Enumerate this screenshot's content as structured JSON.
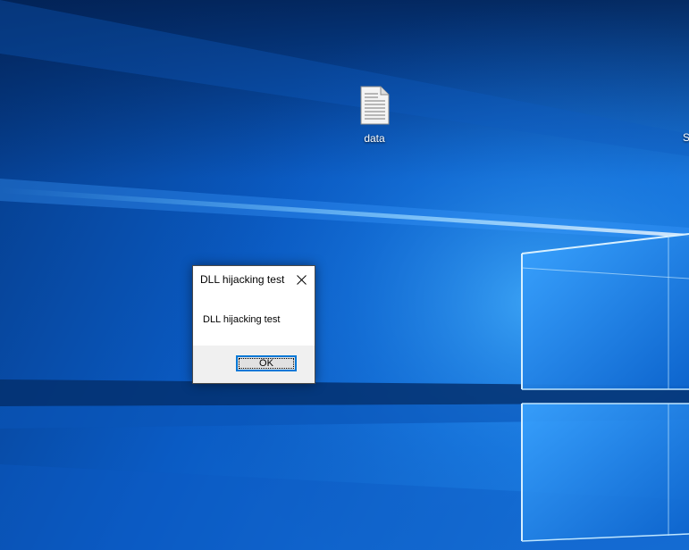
{
  "desktop": {
    "icons": [
      {
        "label": "data",
        "icon": "text-document-icon"
      }
    ],
    "partial_icon_label": "S"
  },
  "dialog": {
    "title": "DLL hijacking test",
    "message": "DLL hijacking test",
    "ok_label": "OK",
    "close_icon": "close-icon"
  },
  "colors": {
    "wallpaper_dark": "#052a63",
    "wallpaper_mid": "#0b53b5",
    "wallpaper_light": "#3aa7ff",
    "dialog_footer": "#f0f0f0",
    "button_focus": "#0078d7"
  }
}
